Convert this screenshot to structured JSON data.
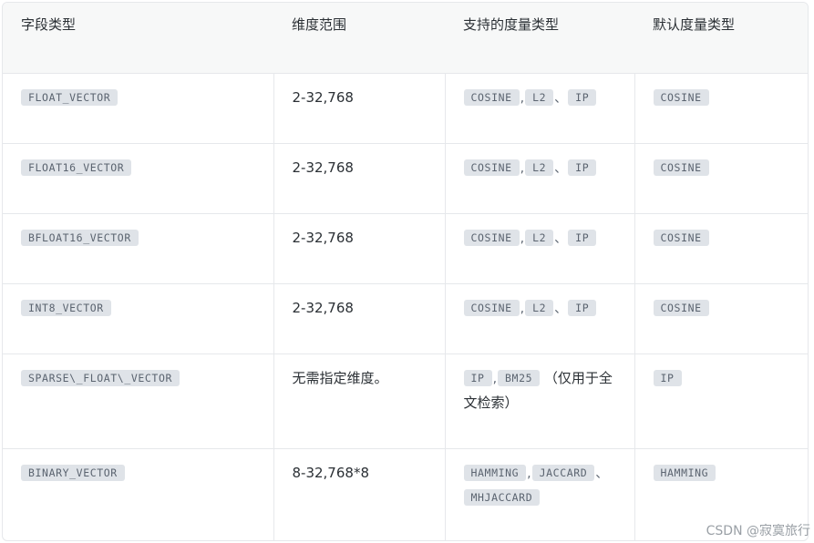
{
  "table": {
    "headers": [
      "字段类型",
      "维度范围",
      "支持的度量类型",
      "默认度量类型"
    ],
    "rows": [
      {
        "field_type": "FLOAT_VECTOR",
        "dim_range": "2-32,768",
        "metrics": [
          "COSINE",
          "L2",
          "IP"
        ],
        "metric_seps": [
          ",",
          "、"
        ],
        "note": "",
        "default": "COSINE"
      },
      {
        "field_type": "FLOAT16_VECTOR",
        "dim_range": "2-32,768",
        "metrics": [
          "COSINE",
          "L2",
          "IP"
        ],
        "metric_seps": [
          ",",
          "、"
        ],
        "note": "",
        "default": "COSINE"
      },
      {
        "field_type": "BFLOAT16_VECTOR",
        "dim_range": "2-32,768",
        "metrics": [
          "COSINE",
          "L2",
          "IP"
        ],
        "metric_seps": [
          ",",
          "、"
        ],
        "note": "",
        "default": "COSINE"
      },
      {
        "field_type": "INT8_VECTOR",
        "dim_range": "2-32,768",
        "metrics": [
          "COSINE",
          "L2",
          "IP"
        ],
        "metric_seps": [
          ",",
          "、"
        ],
        "note": "",
        "default": "COSINE"
      },
      {
        "field_type": "SPARSE\\_FLOAT\\_VECTOR",
        "dim_range": "无需指定维度。",
        "metrics": [
          "IP",
          "BM25"
        ],
        "metric_seps": [
          ","
        ],
        "note": "（仅用于全文检索）",
        "default": "IP"
      },
      {
        "field_type": "BINARY_VECTOR",
        "dim_range": "8-32,768*8",
        "metrics": [
          "HAMMING",
          "JACCARD",
          "MHJACCARD"
        ],
        "metric_seps": [
          ",",
          "、"
        ],
        "note": "",
        "default": "HAMMING"
      }
    ]
  },
  "watermark": "CSDN @寂寞旅行"
}
